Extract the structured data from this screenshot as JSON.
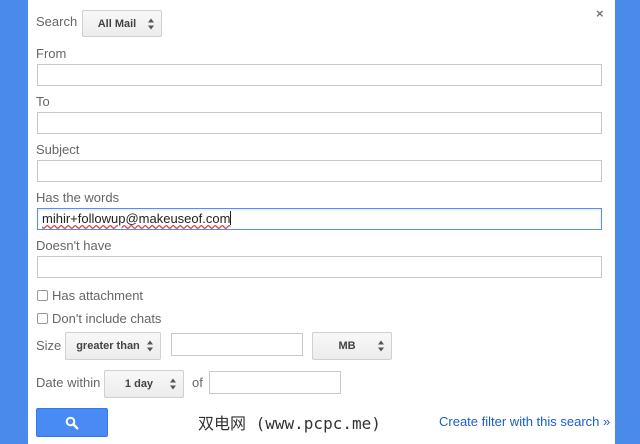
{
  "dialog": {
    "close_glyph": "×",
    "search_label": "Search",
    "search_scope": "All Mail",
    "from_label": "From",
    "from_value": "",
    "to_label": "To",
    "to_value": "",
    "subject_label": "Subject",
    "subject_value": "",
    "has_words_label": "Has the words",
    "has_words_value": "mihir+followup@makeuseof.com",
    "doesnt_have_label": "Doesn't have",
    "doesnt_have_value": "",
    "has_attachment_label": "Has attachment",
    "has_attachment_checked": false,
    "dont_include_chats_label": "Don't include chats",
    "dont_include_chats_checked": false,
    "size_label": "Size",
    "size_operator": "greater than",
    "size_value": "",
    "size_unit": "MB",
    "date_within_label": "Date within",
    "date_within_value": "1 day",
    "of_label": "of",
    "of_value": "",
    "create_filter_link": "Create filter with this search »"
  },
  "watermark": "双电网 (www.pcpc.me)",
  "colors": {
    "background": "#4a8ae8",
    "search_button": "#4a8af4",
    "link": "#1a5ec9",
    "focus_border": "#4d90fe"
  },
  "icons": {
    "search_button_icon": "magnifier-icon",
    "close_icon": "close-icon"
  }
}
